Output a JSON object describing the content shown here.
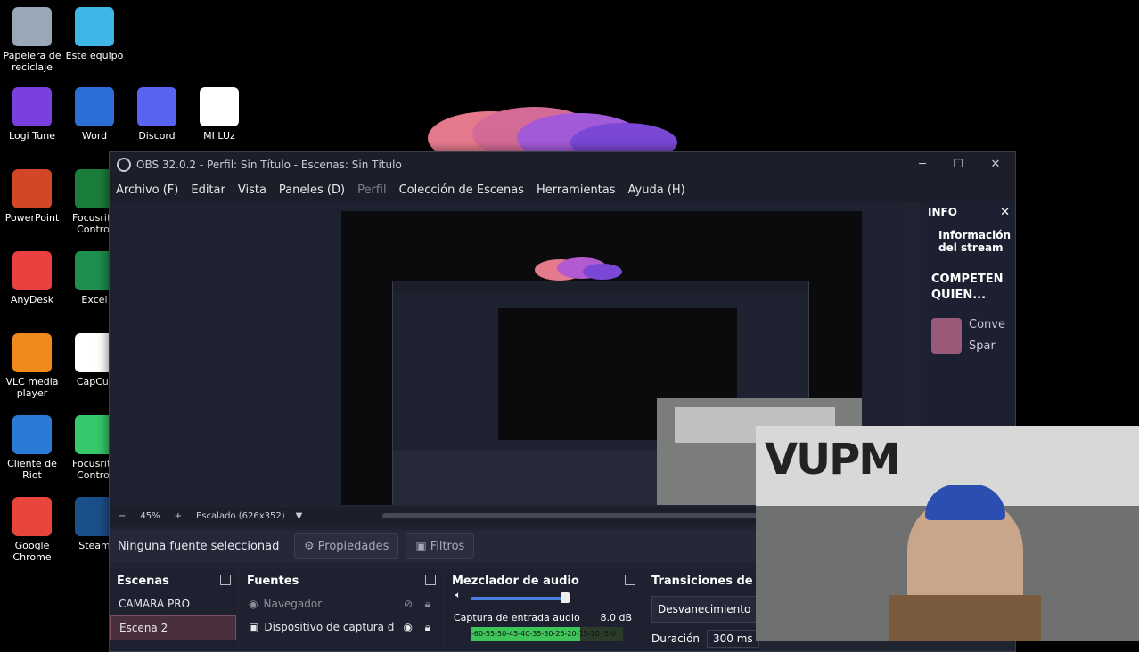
{
  "desktop": {
    "icons": [
      {
        "label": "Papelera de reciclaje",
        "icon": "recycle-bin-icon",
        "color": "#9aa7b6"
      },
      {
        "label": "Este equipo",
        "icon": "monitor-icon",
        "color": "#3fb6e8"
      },
      {
        "label": "Logi Tune",
        "icon": "logi-tune-icon",
        "color": "#7b3fe0"
      },
      {
        "label": "Word",
        "icon": "word-icon",
        "color": "#2b6fd6"
      },
      {
        "label": "Discord",
        "icon": "discord-icon",
        "color": "#5865f2"
      },
      {
        "label": "MI LUz",
        "icon": "video-file-icon",
        "color": "#ffffff"
      },
      {
        "label": "PowerPoint",
        "icon": "powerpoint-icon",
        "color": "#d24726"
      },
      {
        "label": "Focusrite Control",
        "icon": "focusrite-icon",
        "color": "#1a7d3a"
      },
      {
        "label": "AnyDesk",
        "icon": "anydesk-icon",
        "color": "#e8413f"
      },
      {
        "label": "Excel",
        "icon": "excel-icon",
        "color": "#1d8f4e"
      },
      {
        "label": "VLC media player",
        "icon": "vlc-icon",
        "color": "#f08a1c"
      },
      {
        "label": "CapCut",
        "icon": "capcut-icon",
        "color": "#ffffff"
      },
      {
        "label": "Cliente de Riot",
        "icon": "riot-client-icon",
        "color": "#2a7ad6"
      },
      {
        "label": "Focusrite Control",
        "icon": "focusrite-bars-icon",
        "color": "#36c86a"
      },
      {
        "label": "Google Chrome",
        "icon": "chrome-icon",
        "color": "#e8453c"
      },
      {
        "label": "Steam",
        "icon": "steam-icon",
        "color": "#1b4f8a"
      }
    ]
  },
  "obs": {
    "title": "OBS 32.0.2 - Perfil: Sin Título - Escenas: Sin Título",
    "menu": [
      "Archivo (F)",
      "Editar",
      "Vista",
      "Paneles (D)",
      "Perfil",
      "Colección de Escenas",
      "Herramientas",
      "Ayuda (H)"
    ],
    "zoom": {
      "percent": "45%",
      "scale_label": "Escalado (626x352)"
    },
    "source_bar": {
      "no_source": "Ninguna fuente seleccionad",
      "properties": "Propiedades",
      "filters": "Filtros"
    },
    "info": {
      "header": "INFO",
      "stream_info": "Información del stream",
      "title_line1": "COMPETEN",
      "title_line2": "QUIEN...",
      "row1": "Conve",
      "row2": "Spar"
    },
    "scenes": {
      "header": "Escenas",
      "items": [
        "CAMARA PRO",
        "Escena 2"
      ]
    },
    "sources": {
      "header": "Fuentes",
      "items": [
        "Navegador",
        "Dispositivo de captura d"
      ]
    },
    "mixer": {
      "header": "Mezclador de audio",
      "track": "Captura de entrada audio",
      "db": "8.0 dB",
      "scale": "-60-55-50-45-40-35-30-25-20-15-10 -5 0",
      "level": 0.72
    },
    "transitions": {
      "header": "Transiciones de esc",
      "selected": "Desvanecimiento",
      "duration_label": "Duración",
      "duration_value": "300 ms"
    }
  }
}
